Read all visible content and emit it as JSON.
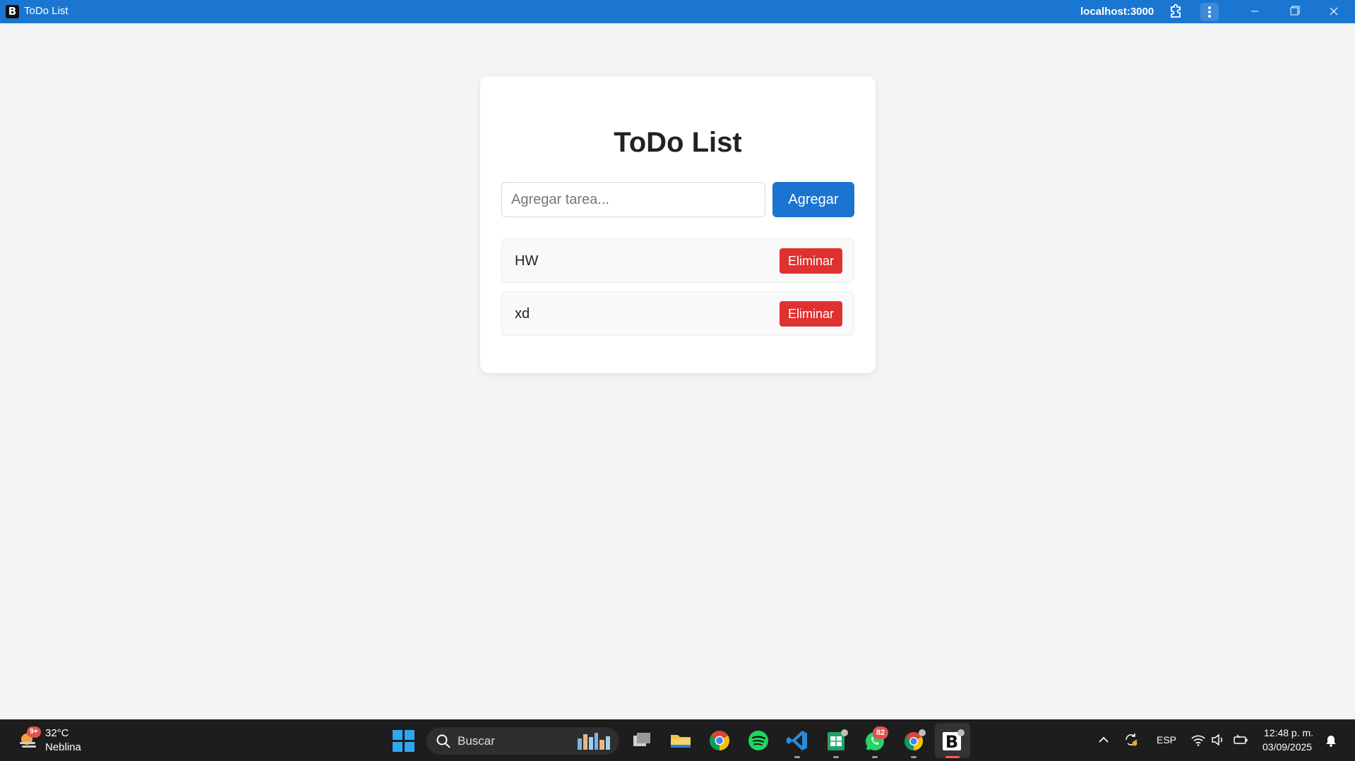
{
  "window": {
    "title": "ToDo List",
    "url": "localhost:3000",
    "accent_color": "#1b76d2"
  },
  "app": {
    "title": "ToDo List",
    "input_placeholder": "Agregar tarea...",
    "input_value": "",
    "add_label": "Agregar",
    "tasks": [
      {
        "label": "HW",
        "delete_label": "Eliminar"
      },
      {
        "label": "xd",
        "delete_label": "Eliminar"
      }
    ],
    "primary_color": "#1b74d0",
    "danger_color": "#e03131"
  },
  "taskbar": {
    "weather_badge": "9+",
    "temperature": "32°C",
    "condition": "Neblina",
    "search_placeholder": "Buscar",
    "whatsapp_badge": "82",
    "language": "ESP",
    "time": "12:48 p. m.",
    "date": "03/09/2025",
    "apps": [
      "task-view",
      "file-explorer",
      "chrome",
      "spotify",
      "vscode",
      "spreadsheet",
      "whatsapp",
      "chrome-profile",
      "todo-app"
    ]
  }
}
